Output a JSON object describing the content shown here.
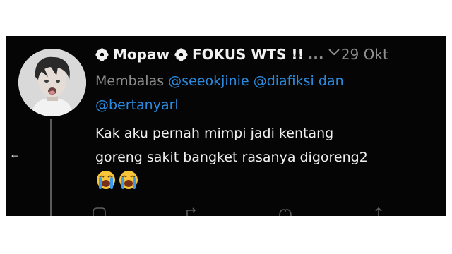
{
  "tweet": {
    "display_name": "Mopaw",
    "display_name_2": "FOKUS WTS !!",
    "ellipsis": "...",
    "separator": "·",
    "date": "29 Okt",
    "replying_label": "Membalas",
    "mention_1": "@seeokjinie",
    "mention_2": "@diafiksi",
    "conjunction": "dan",
    "mention_3": "@bertanyarl",
    "text_line_1": "Kak aku pernah mimpi jadi kentang",
    "text_line_2": "goreng sakit bangket rasanya digoreng2",
    "emojis": [
      "loudly-crying-face",
      "loudly-crying-face"
    ]
  },
  "icons": {
    "back": "←",
    "flower_1": "flower-icon",
    "flower_2": "flower-icon",
    "more": "chevron-down-icon",
    "actions": [
      "reply-icon",
      "retweet-icon",
      "like-icon",
      "share-icon"
    ]
  },
  "colors": {
    "background": "#050505",
    "text": "#f0f0f0",
    "muted": "#8e8e8e",
    "mention": "#2b8be0"
  }
}
